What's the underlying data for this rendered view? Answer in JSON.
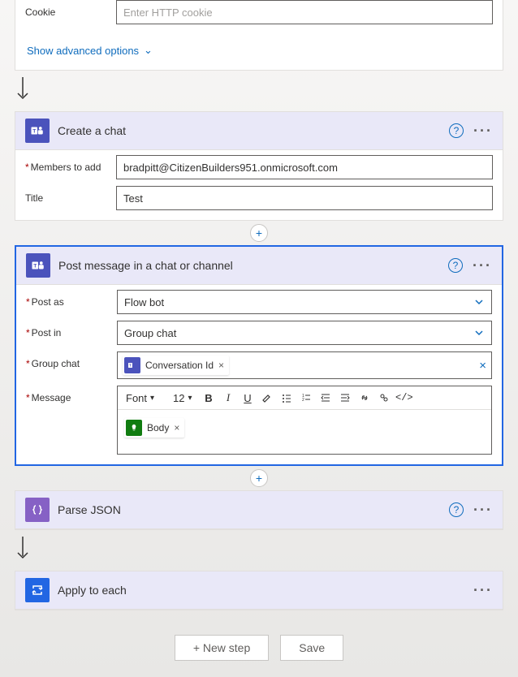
{
  "http_card": {
    "cookie_label": "Cookie",
    "cookie_placeholder": "Enter HTTP cookie",
    "advanced_link": "Show advanced options"
  },
  "create_chat": {
    "title": "Create a chat",
    "fields": {
      "members_label": "Members to add",
      "members_value": "bradpitt@CitizenBuilders951.onmicrosoft.com",
      "title_label": "Title",
      "title_value": "Test"
    }
  },
  "post_message": {
    "title": "Post message in a chat or channel",
    "fields": {
      "post_as_label": "Post as",
      "post_as_value": "Flow bot",
      "post_in_label": "Post in",
      "post_in_value": "Group chat",
      "group_chat_label": "Group chat",
      "group_chat_token": "Conversation Id",
      "message_label": "Message",
      "message_token": "Body",
      "font_label": "Font",
      "font_size": "12"
    }
  },
  "parse_json": {
    "title": "Parse JSON"
  },
  "apply_each": {
    "title": "Apply to each"
  },
  "footer": {
    "new_step": "+ New step",
    "save": "Save"
  },
  "icons": {
    "help": "?",
    "ellipsis": "···",
    "add": "+",
    "remove": "×",
    "clear": "×",
    "caret": "▾",
    "chevron_down": "⌄"
  }
}
